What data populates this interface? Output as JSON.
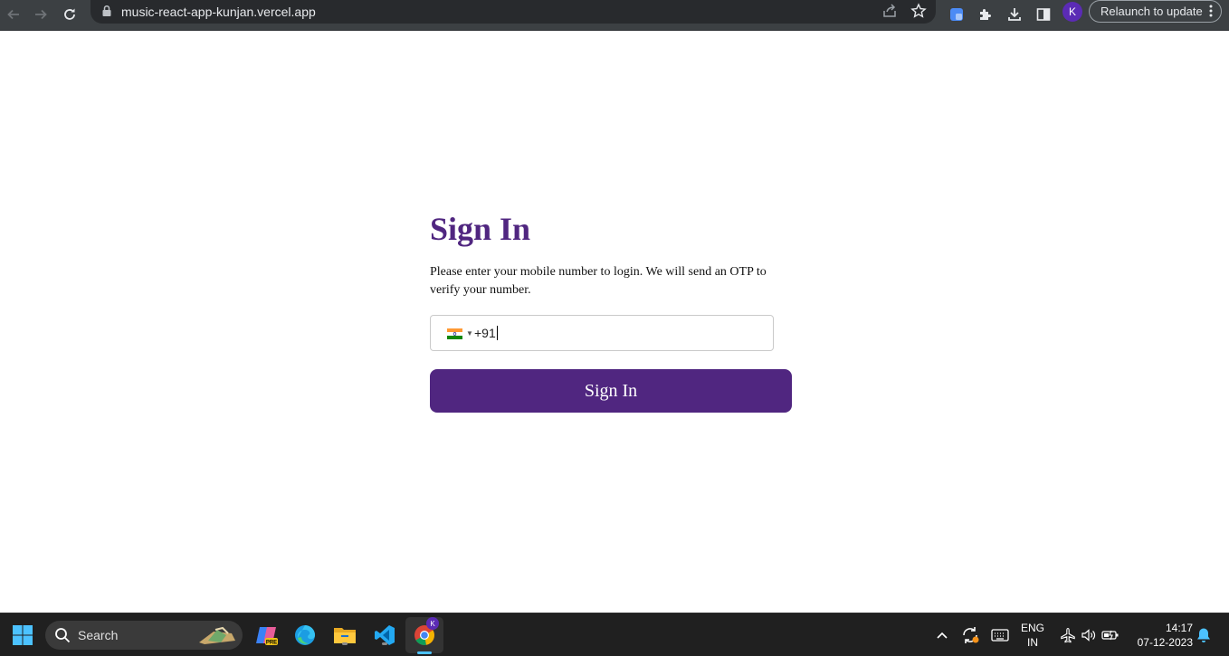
{
  "browser": {
    "url": "music-react-app-kunjan.vercel.app",
    "profile_initial": "K",
    "relaunch_label": "Relaunch to update"
  },
  "signin": {
    "title": "Sign In",
    "description": "Please enter your mobile number to login. We will send an OTP to verify your number.",
    "country_code": "+91",
    "button_label": "Sign In"
  },
  "taskbar": {
    "search_label": "Search",
    "language_line1": "ENG",
    "language_line2": "IN",
    "time": "14:17",
    "date": "07-12-2023",
    "chrome_badge": "K"
  },
  "colors": {
    "accent": "#502680",
    "toolbar": "#3c4043",
    "taskbar": "#202020"
  }
}
